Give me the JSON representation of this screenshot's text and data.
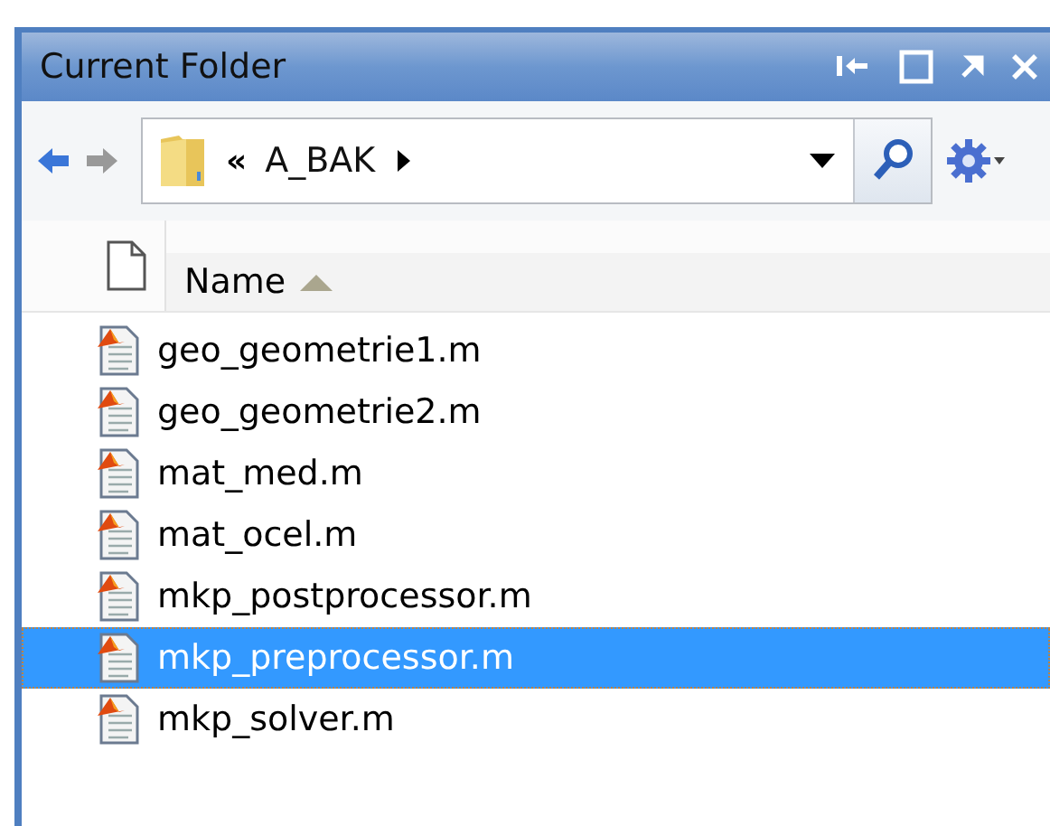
{
  "window": {
    "title": "Current Folder"
  },
  "address": {
    "chevrons": "«",
    "folder": "A_BAK"
  },
  "table": {
    "columns": [
      {
        "label": "Name",
        "sort_ascending": true
      }
    ],
    "rows": [
      {
        "name": "geo_geometrie1.m",
        "selected": false
      },
      {
        "name": "geo_geometrie2.m",
        "selected": false
      },
      {
        "name": "mat_med.m",
        "selected": false
      },
      {
        "name": "mat_ocel.m",
        "selected": false
      },
      {
        "name": "mkp_postprocessor.m",
        "selected": false
      },
      {
        "name": "mkp_preprocessor.m",
        "selected": true
      },
      {
        "name": "mkp_solver.m",
        "selected": false
      }
    ]
  }
}
